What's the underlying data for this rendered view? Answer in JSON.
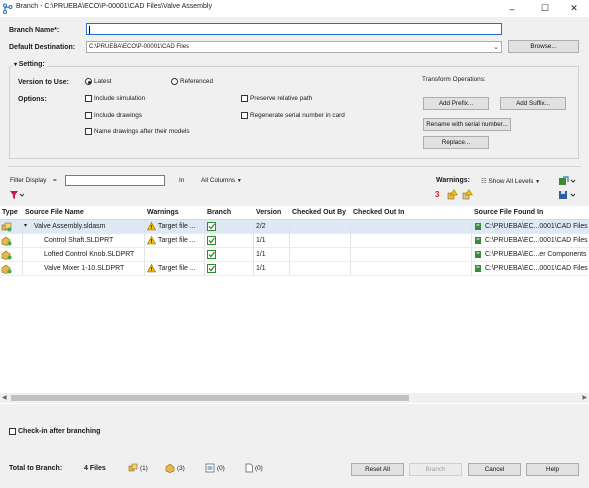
{
  "window": {
    "title": "Branch - C:\\PRUEBA\\ECO\\P-00001\\CAD Files\\Valve Assembly",
    "minimize_glyph": "–",
    "maximize_glyph": "☐",
    "close_glyph": "✕"
  },
  "form": {
    "branch_name_label": "Branch Name*:",
    "branch_name_value": "",
    "default_destination_label": "Default Destination:",
    "default_destination_value": "C:\\PRUEBA\\ECO\\P-00001\\CAD Files",
    "browse_label": "Browse..."
  },
  "setting": {
    "header": "Setting:",
    "version_to_use_label": "Version to Use:",
    "latest_label": "Latest",
    "referenced_label": "Referenced",
    "options_label": "Options:",
    "include_simulation": "Include simulation",
    "include_drawings": "Include drawings",
    "name_drawings": "Name drawings after their models",
    "preserve_relative_path": "Preserve relative path",
    "regenerate_serial": "Regenerate serial number in card",
    "transform_label": "Transform Operations:",
    "add_prefix": "Add Prefix...",
    "add_suffix": "Add Suffix...",
    "rename_serial": "Rename with serial number...",
    "replace": "Replace..."
  },
  "filter": {
    "label": "Filter Display",
    "equals": "=",
    "value": "",
    "in_label": "In",
    "columns_value": "All Columns",
    "warnings_label": "Warnings:",
    "warnings_count": "3",
    "show_levels": "Show All Levels"
  },
  "table": {
    "columns": [
      "Type",
      "Source File Name",
      "Warnings",
      "Branch",
      "Version",
      "Checked Out By",
      "Checked Out In",
      "Source File Found In"
    ],
    "rows": [
      {
        "name": "Valve Assembly.sldasm",
        "warning": "Target file ...",
        "branch": true,
        "version": "2/2",
        "found_in": "C:\\PRUEBA\\EC...0001\\CAD Files",
        "type_icon": "assembly-icon"
      },
      {
        "name": "Control Shaft.SLDPRT",
        "warning": "Target file ...",
        "branch": true,
        "version": "1/1",
        "found_in": "C:\\PRUEBA\\EC...0001\\CAD Files",
        "type_icon": "part-icon"
      },
      {
        "name": "Lofted Control Knob.SLDPRT",
        "warning": "",
        "branch": true,
        "version": "1/1",
        "found_in": "C:\\PRUEBA\\EC...er Components",
        "type_icon": "part-icon"
      },
      {
        "name": "Valve Mixer 1-10.SLDPRT",
        "warning": "Target file ...",
        "branch": true,
        "version": "1/1",
        "found_in": "C:\\PRUEBA\\EC...0001\\CAD Files",
        "type_icon": "part-icon"
      }
    ]
  },
  "footer": {
    "checkin_label": "Check-in after branching",
    "total_label": "Total to Branch:",
    "total_value": "4 Files",
    "counts": [
      "(1)",
      "(3)",
      "(0)",
      "(0)"
    ],
    "reset_all": "Reset All",
    "branch": "Branch",
    "cancel": "Cancel",
    "help": "Help"
  },
  "colors": {
    "accent_selection": "#dfe9f5",
    "warning_yellow": "#f2c200",
    "check_green": "#2e8b2e",
    "error_red": "#d32020"
  }
}
